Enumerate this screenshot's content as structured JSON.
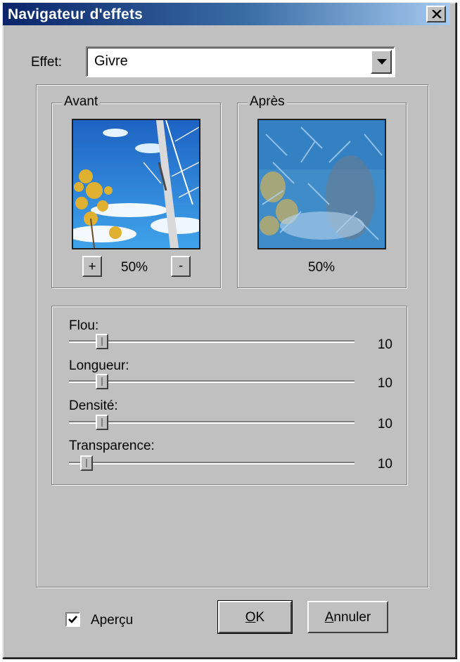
{
  "window": {
    "title": "Navigateur d'effets"
  },
  "effect": {
    "label": "Effet:",
    "value": "Givre"
  },
  "before": {
    "label": "Avant",
    "zoom": "50%",
    "zoom_in": "+",
    "zoom_out": "-"
  },
  "after": {
    "label": "Après",
    "zoom": "50%"
  },
  "sliders": [
    {
      "label": "Flou:",
      "value": "10"
    },
    {
      "label": "Longueur:",
      "value": "10"
    },
    {
      "label": "Densité:",
      "value": "10"
    },
    {
      "label": "Transparence:",
      "value": "10"
    }
  ],
  "preview_checkbox": {
    "label": "Aperçu",
    "checked": true
  },
  "buttons": {
    "ok_mnemonic": "O",
    "ok_rest": "K",
    "cancel_mnemonic": "A",
    "cancel_rest": "nnuler"
  }
}
